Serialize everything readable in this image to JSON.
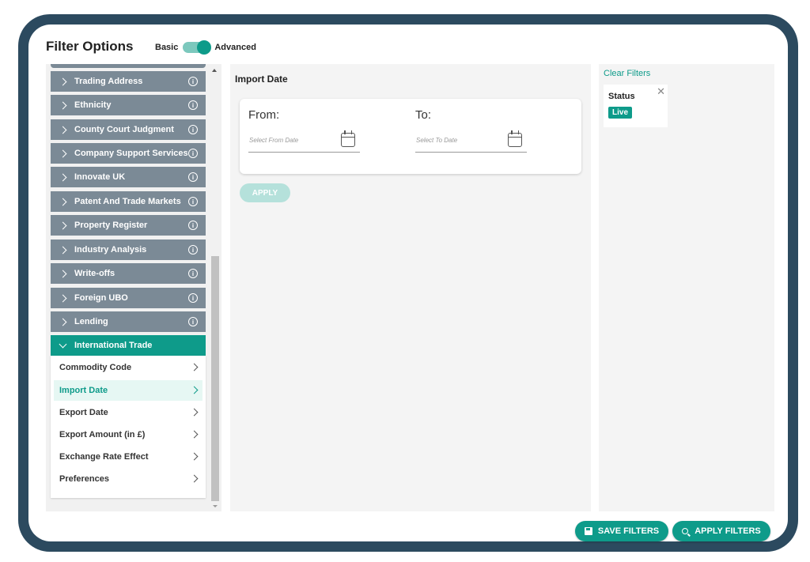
{
  "header": {
    "title": "Filter Options",
    "mode_basic": "Basic",
    "mode_advanced": "Advanced",
    "mode_selected": "Advanced"
  },
  "sidebar": {
    "categories": [
      {
        "label": "Trading Address"
      },
      {
        "label": "Ethnicity"
      },
      {
        "label": "County Court Judgment"
      },
      {
        "label": "Company Support Services"
      },
      {
        "label": "Innovate UK"
      },
      {
        "label": "Patent And Trade Markets"
      },
      {
        "label": "Property Register"
      },
      {
        "label": "Industry Analysis"
      },
      {
        "label": "Write-offs"
      },
      {
        "label": "Foreign UBO"
      },
      {
        "label": "Lending"
      }
    ],
    "expanded": {
      "label": "International Trade",
      "items": [
        {
          "label": "Commodity Code"
        },
        {
          "label": "Import Date"
        },
        {
          "label": "Export Date"
        },
        {
          "label": "Export Amount (in £)"
        },
        {
          "label": "Exchange Rate Effect"
        },
        {
          "label": "Preferences"
        }
      ],
      "selected": "Import Date"
    }
  },
  "main": {
    "title": "Import Date",
    "from_label": "From:",
    "to_label": "To:",
    "from_placeholder": "Select From Date",
    "to_placeholder": "Select To Date",
    "apply_label": "APPLY"
  },
  "filters_panel": {
    "clear_label": "Clear Filters",
    "chips": [
      {
        "title": "Status",
        "value": "Live"
      }
    ]
  },
  "footer": {
    "save_label": "SAVE FILTERS",
    "apply_label": "APPLY FILTERS"
  },
  "colors": {
    "accent": "#0e9b8a",
    "category_bg": "#7b8a96",
    "frame": "#2c4a5f"
  },
  "icons": {
    "info": "info-icon",
    "chevron": "chevron-right-icon",
    "calendar": "calendar-icon",
    "close": "close-icon",
    "save": "floppy-disk-icon",
    "search": "search-icon"
  }
}
